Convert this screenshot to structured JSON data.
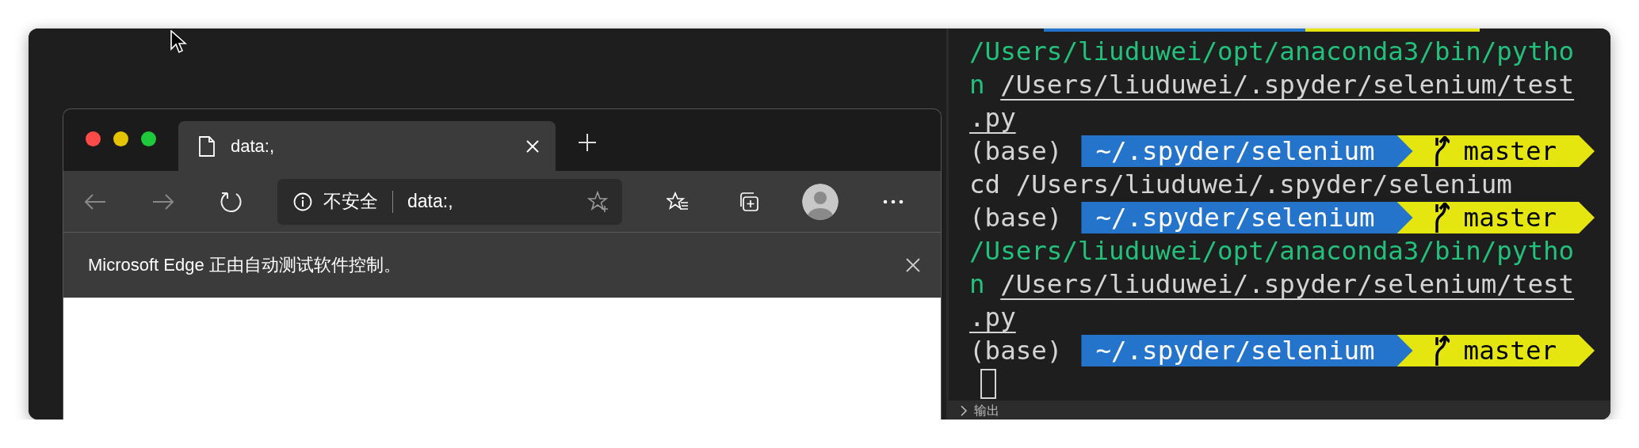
{
  "browser": {
    "tab": {
      "title": "data:,",
      "selected": true
    },
    "address": {
      "security": "不安全",
      "url": "data:,"
    },
    "infobar": {
      "message": "Microsoft Edge 正由自动测试软件控制。"
    }
  },
  "terminal": {
    "lines": [
      {
        "kind": "text",
        "segments": [
          {
            "kind": "command",
            "text": "/Users/liuduwei/opt/anaconda3/bin/pytho"
          }
        ]
      },
      {
        "kind": "text",
        "segments": [
          {
            "kind": "command",
            "text": "n "
          },
          {
            "kind": "path",
            "text": "/Users/liuduwei/.spyder/selenium/test"
          }
        ]
      },
      {
        "kind": "text",
        "segments": [
          {
            "kind": "path",
            "text": ".py"
          }
        ]
      },
      {
        "kind": "prompt",
        "env": "(base)",
        "dir": "~/.spyder/selenium",
        "branch": "master"
      },
      {
        "kind": "text",
        "segments": [
          {
            "kind": "plain",
            "text": "cd /Users/liuduwei/.spyder/selenium"
          }
        ]
      },
      {
        "kind": "prompt",
        "env": "(base)",
        "dir": "~/.spyder/selenium",
        "branch": "master"
      },
      {
        "kind": "text",
        "segments": [
          {
            "kind": "command",
            "text": "/Users/liuduwei/opt/anaconda3/bin/pytho"
          }
        ]
      },
      {
        "kind": "text",
        "segments": [
          {
            "kind": "command",
            "text": "n "
          },
          {
            "kind": "path",
            "text": "/Users/liuduwei/.spyder/selenium/test"
          }
        ]
      },
      {
        "kind": "text",
        "segments": [
          {
            "kind": "path",
            "text": ".py"
          }
        ]
      },
      {
        "kind": "prompt",
        "env": "(base)",
        "dir": "~/.spyder/selenium",
        "branch": "master"
      },
      {
        "kind": "cursor"
      }
    ],
    "panel": {
      "title": "输出",
      "expanded": false
    }
  }
}
